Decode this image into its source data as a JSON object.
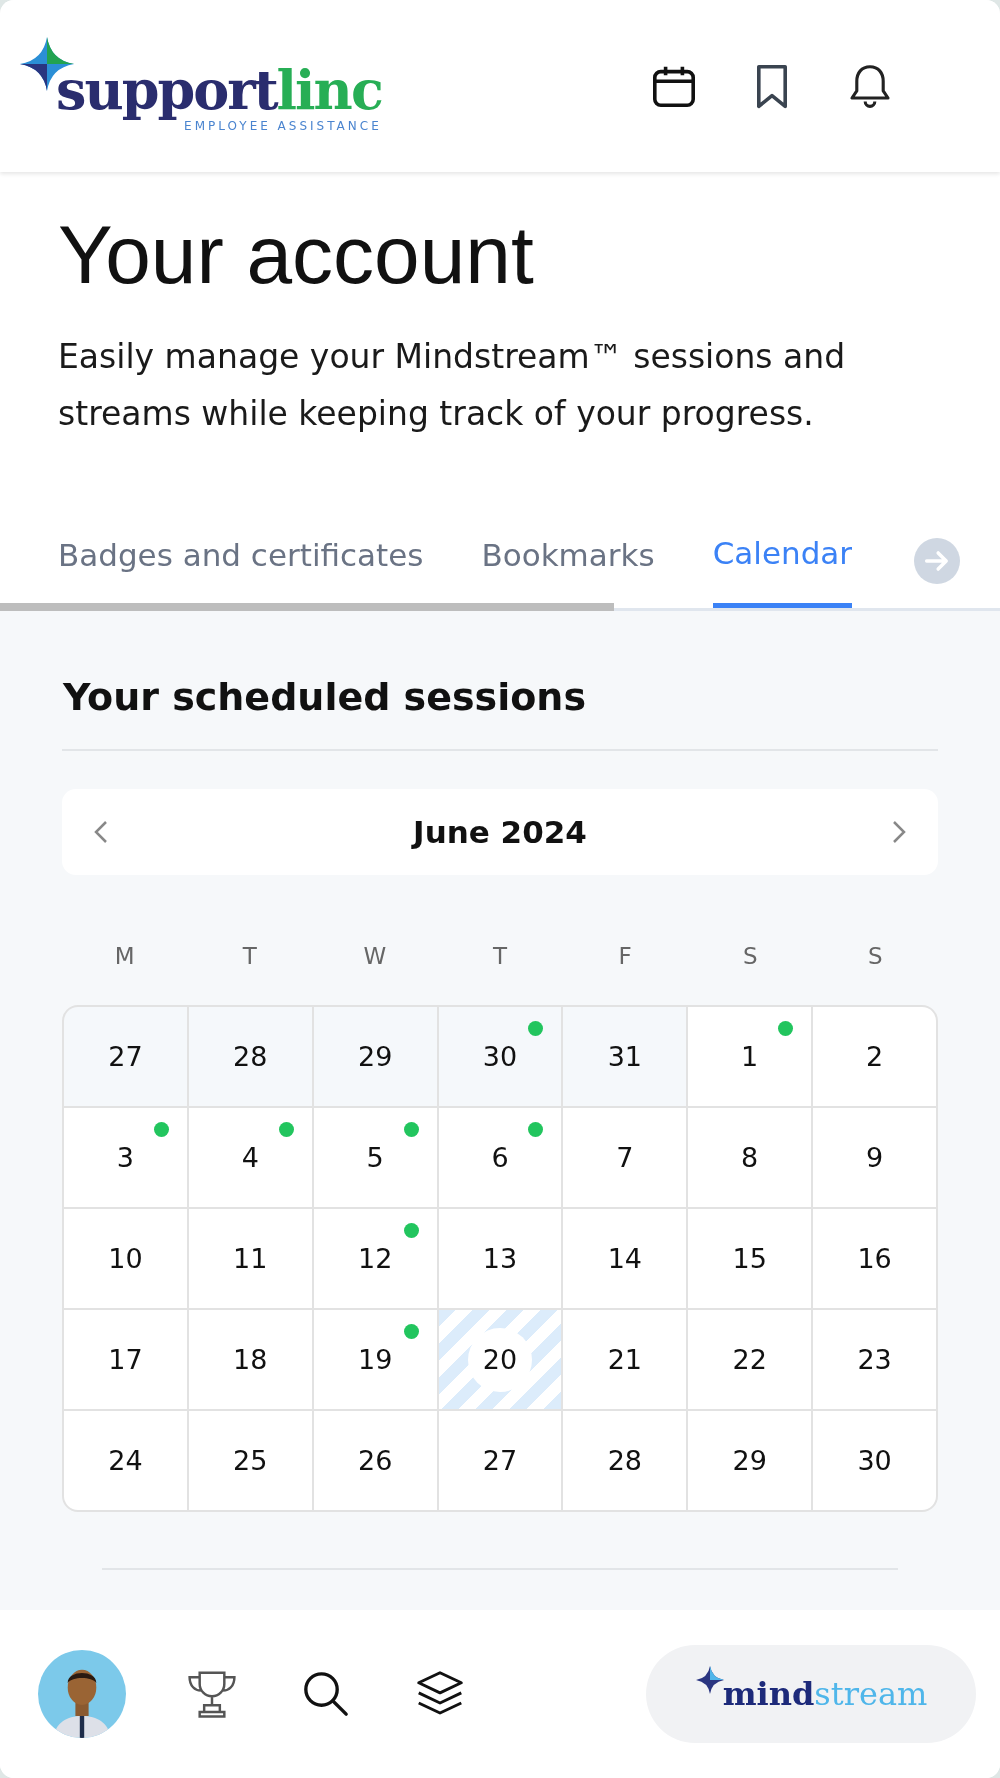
{
  "header": {
    "logo": {
      "part_1": "support",
      "part_2": "linc",
      "tagline": "EMPLOYEE ASSISTANCE"
    }
  },
  "page": {
    "title": "Your account",
    "description": "Easily manage your Mindstream™ sessions and streams while keeping track of your progress."
  },
  "tabs": [
    {
      "label": "Badges and certificates",
      "selected": false
    },
    {
      "label": "Bookmarks",
      "selected": false
    },
    {
      "label": "Calendar",
      "selected": true
    }
  ],
  "calendar": {
    "heading": "Your scheduled sessions",
    "month": "June 2024",
    "weekdays": [
      "M",
      "T",
      "W",
      "T",
      "F",
      "S",
      "S"
    ],
    "days": [
      {
        "label": "27",
        "outside": true,
        "session": false,
        "today": false
      },
      {
        "label": "28",
        "outside": true,
        "session": false,
        "today": false
      },
      {
        "label": "29",
        "outside": true,
        "session": false,
        "today": false
      },
      {
        "label": "30",
        "outside": true,
        "session": true,
        "today": false
      },
      {
        "label": "31",
        "outside": true,
        "session": false,
        "today": false
      },
      {
        "label": "1",
        "outside": false,
        "session": true,
        "today": false
      },
      {
        "label": "2",
        "outside": false,
        "session": false,
        "today": false
      },
      {
        "label": "3",
        "outside": false,
        "session": true,
        "today": false
      },
      {
        "label": "4",
        "outside": false,
        "session": true,
        "today": false
      },
      {
        "label": "5",
        "outside": false,
        "session": true,
        "today": false
      },
      {
        "label": "6",
        "outside": false,
        "session": true,
        "today": false
      },
      {
        "label": "7",
        "outside": false,
        "session": false,
        "today": false
      },
      {
        "label": "8",
        "outside": false,
        "session": false,
        "today": false
      },
      {
        "label": "9",
        "outside": false,
        "session": false,
        "today": false
      },
      {
        "label": "10",
        "outside": false,
        "session": false,
        "today": false
      },
      {
        "label": "11",
        "outside": false,
        "session": false,
        "today": false
      },
      {
        "label": "12",
        "outside": false,
        "session": true,
        "today": false
      },
      {
        "label": "13",
        "outside": false,
        "session": false,
        "today": false
      },
      {
        "label": "14",
        "outside": false,
        "session": false,
        "today": false
      },
      {
        "label": "15",
        "outside": false,
        "session": false,
        "today": false
      },
      {
        "label": "16",
        "outside": false,
        "session": false,
        "today": false
      },
      {
        "label": "17",
        "outside": false,
        "session": false,
        "today": false
      },
      {
        "label": "18",
        "outside": false,
        "session": false,
        "today": false
      },
      {
        "label": "19",
        "outside": false,
        "session": true,
        "today": false
      },
      {
        "label": "20",
        "outside": false,
        "session": false,
        "today": true
      },
      {
        "label": "21",
        "outside": false,
        "session": false,
        "today": false
      },
      {
        "label": "22",
        "outside": false,
        "session": false,
        "today": false
      },
      {
        "label": "23",
        "outside": false,
        "session": false,
        "today": false
      },
      {
        "label": "24",
        "outside": false,
        "session": false,
        "today": false
      },
      {
        "label": "25",
        "outside": false,
        "session": false,
        "today": false
      },
      {
        "label": "26",
        "outside": false,
        "session": false,
        "today": false
      },
      {
        "label": "27",
        "outside": false,
        "session": false,
        "today": false
      },
      {
        "label": "28",
        "outside": false,
        "session": false,
        "today": false
      },
      {
        "label": "29",
        "outside": false,
        "session": false,
        "today": false
      },
      {
        "label": "30",
        "outside": false,
        "session": false,
        "today": false
      }
    ]
  },
  "bottom_nav": {
    "brand": {
      "part_1": "mind",
      "part_2": "stream"
    }
  }
}
